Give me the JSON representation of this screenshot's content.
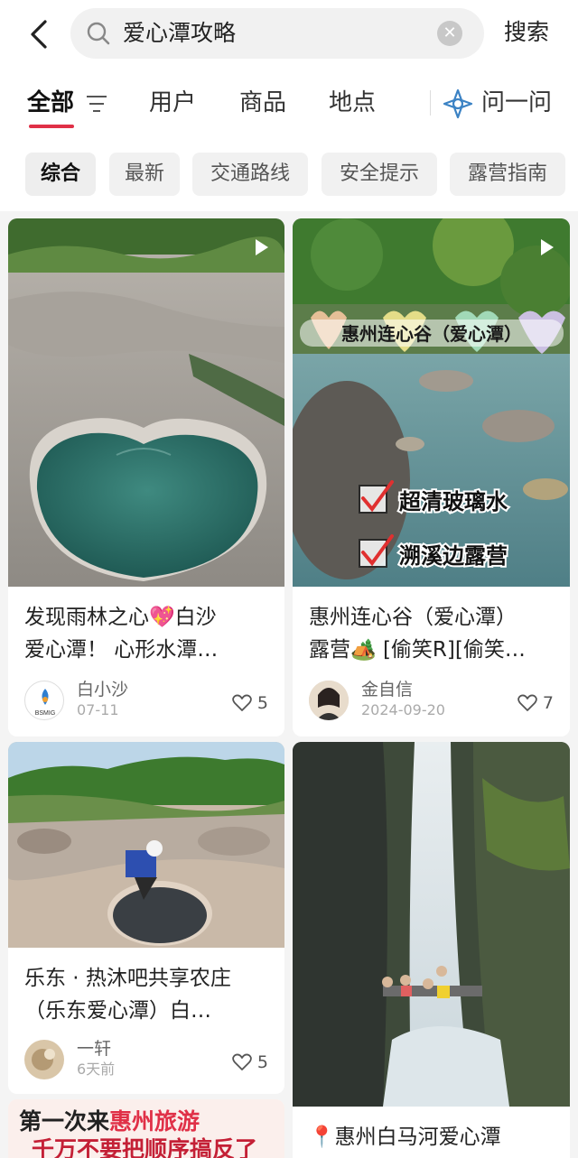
{
  "search": {
    "query": "爱心潭攻略",
    "button_label": "搜索"
  },
  "tabs": [
    {
      "label": "全部"
    },
    {
      "label": "用户"
    },
    {
      "label": "商品"
    },
    {
      "label": "地点"
    },
    {
      "label": "问一问"
    }
  ],
  "chips": [
    "综合",
    "最新",
    "交通路线",
    "安全提示",
    "露营指南"
  ],
  "cards": [
    {
      "title_line1": "发现雨林之心💖白沙",
      "title_line2": "爱心潭！ 心形水潭…",
      "author": "白小沙",
      "avatar_text": "BSMIG",
      "date": "07-11",
      "likes": "5"
    },
    {
      "overlay_title": "惠州连心谷（爱心潭）",
      "overlay_check1": "超清玻璃水",
      "overlay_check2": "溯溪边露营",
      "title_line1": "惠州连心谷（爱心潭）",
      "title_line2": "露营🏕️ [偷笑R][偷笑…",
      "author": "金自信",
      "date": "2024-09-20",
      "likes": "7"
    },
    {
      "title_line1": "乐东 · 热沐吧共享农庄",
      "title_line2": "（乐东爱心潭）白…",
      "author": "一轩",
      "date": "6天前",
      "likes": "5"
    },
    {
      "title_line1": "📍惠州白马河爱心潭"
    },
    {
      "banner_line1_a": "第一次来",
      "banner_line1_b": "惠州旅游",
      "banner_line2": "千万不要把顺序搞反了"
    }
  ],
  "colors": {
    "accent": "#e03047",
    "ask_icon": "#3b82c4"
  }
}
